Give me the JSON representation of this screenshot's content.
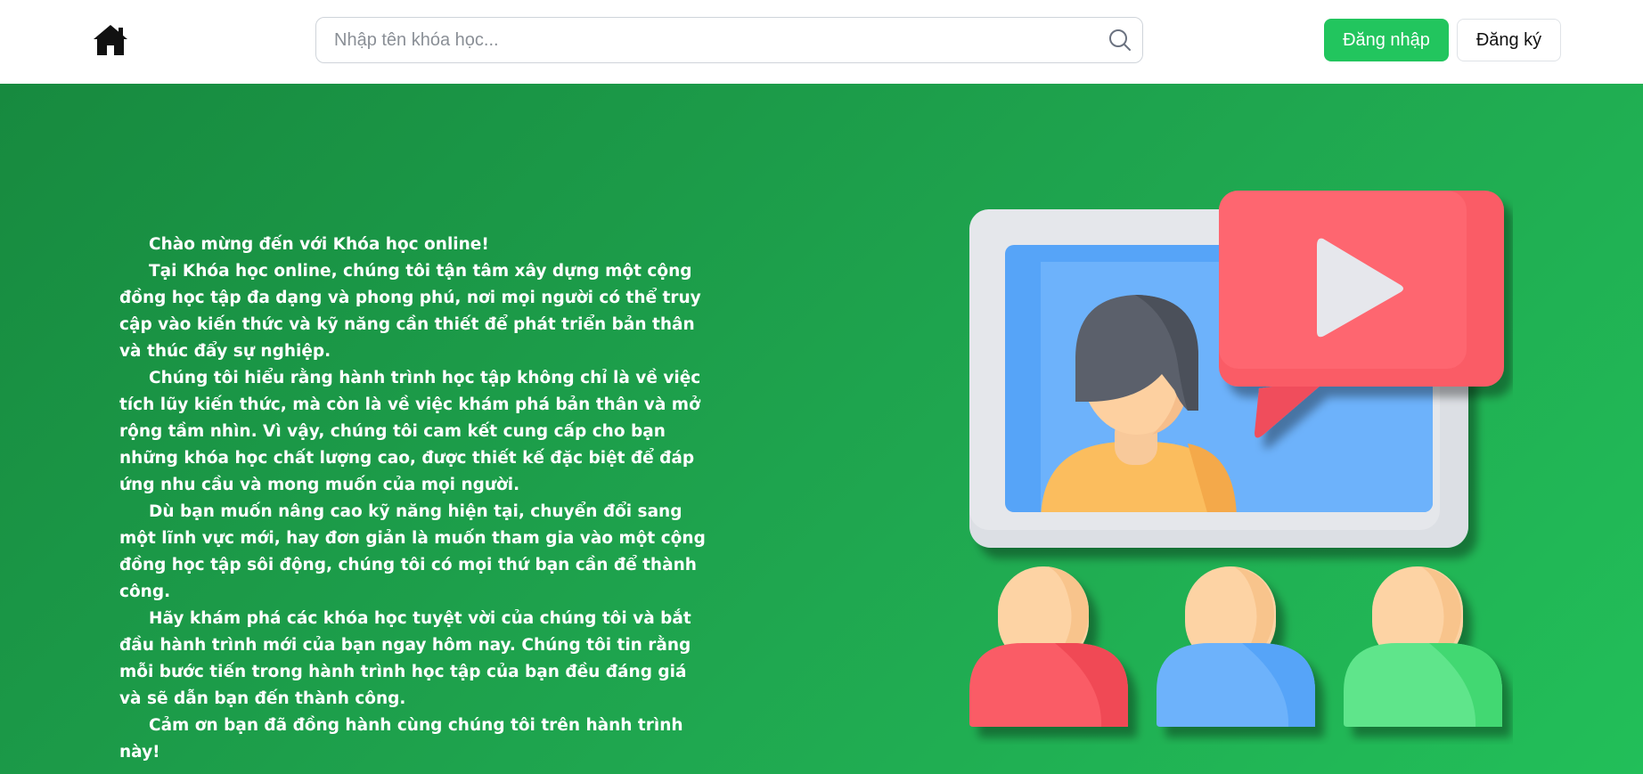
{
  "header": {
    "search_placeholder": "Nhập tên khóa học...",
    "login_label": "Đăng nhập",
    "register_label": "Đăng ký"
  },
  "hero": {
    "paragraphs": [
      "Chào mừng đến với Khóa học online!",
      "Tại Khóa học online, chúng tôi tận tâm xây dựng một cộng đồng học tập đa dạng và phong phú, nơi mọi người có thể truy cập vào kiến thức và kỹ năng cần thiết để phát triển bản thân và thúc đẩy sự nghiệp.",
      "Chúng tôi hiểu rằng hành trình học tập không chỉ là về việc tích lũy kiến thức, mà còn là về việc khám phá bản thân và mở rộng tầm nhìn. Vì vậy, chúng tôi cam kết cung cấp cho bạn những khóa học chất lượng cao, được thiết kế đặc biệt để đáp ứng nhu cầu và mong muốn của mọi người.",
      "Dù bạn muốn nâng cao kỹ năng hiện tại, chuyển đổi sang một lĩnh vực mới, hay đơn giản là muốn tham gia vào một cộng đồng học tập sôi động, chúng tôi có mọi thứ bạn cần để thành công.",
      "Hãy khám phá các khóa học tuyệt vời của chúng tôi và bắt đầu hành trình mới của bạn ngay hôm nay. Chúng tôi tin rằng mỗi bước tiến trong hành trình học tập của bạn đều đáng giá và sẽ dẫn bạn đến thành công.",
      "Cảm ơn bạn đã đồng hành cùng chúng tôi trên hành trình này!"
    ]
  },
  "icons": {
    "home": "home-icon",
    "search": "search-icon",
    "illustration": "online-class-illustration"
  },
  "colors": {
    "accent": "#22c55e",
    "hero_start": "#178a3f",
    "hero_end": "#22bf59"
  }
}
